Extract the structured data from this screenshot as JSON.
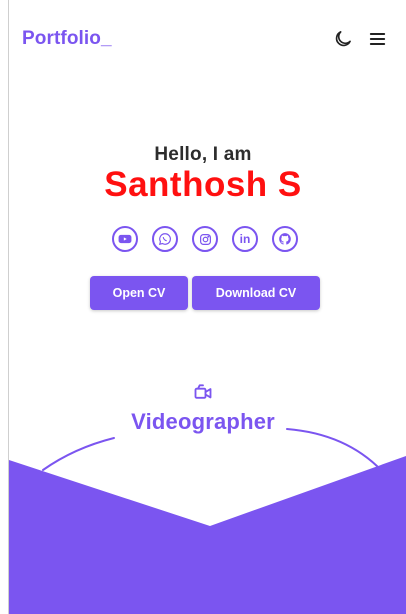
{
  "header": {
    "logo": "Portfolio_",
    "theme_icon": "moon-icon",
    "menu_icon": "hamburger-menu-icon"
  },
  "hero": {
    "greeting": "Hello, I am",
    "name": "Santhosh S"
  },
  "socials": [
    {
      "name": "youtube",
      "icon": "youtube-icon"
    },
    {
      "name": "whatsapp",
      "icon": "whatsapp-icon"
    },
    {
      "name": "instagram",
      "icon": "instagram-icon"
    },
    {
      "name": "linkedin",
      "icon": "linkedin-icon",
      "glyph": "in"
    },
    {
      "name": "github",
      "icon": "github-icon"
    }
  ],
  "buttons": {
    "open_cv": "Open CV",
    "download_cv": "Download CV"
  },
  "role": {
    "icon": "video-camera-icon",
    "label": "Videographer"
  },
  "colors": {
    "accent": "#7b55f0",
    "name_red": "#ff1010",
    "text_dark": "#2d2d2d",
    "background": "#ffffff"
  }
}
